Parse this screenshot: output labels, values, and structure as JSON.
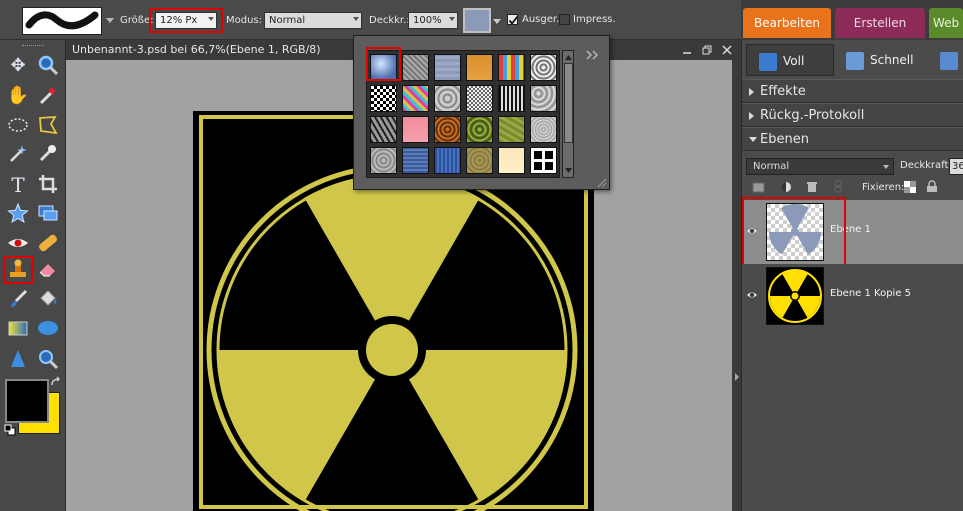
{
  "options_bar": {
    "size_label": "Größe:",
    "size_value": "12% Px",
    "mode_label": "Modus:",
    "mode_value": "Normal",
    "opacity_label": "Deckkr.:",
    "opacity_value": "100%",
    "aligned_label": "Ausger.",
    "aligned_checked": true,
    "impress_label": "Impress.",
    "impress_checked": false
  },
  "mode_tabs": [
    {
      "label": "Bearbeiten",
      "color": "#e8731a"
    },
    {
      "label": "Erstellen",
      "color": "#8c2a58"
    },
    {
      "label": "Web",
      "color": "#5a8a2a"
    }
  ],
  "document": {
    "title": "Unbenannt-3.psd bei 66,7%(Ebene 1, RGB/8)"
  },
  "pattern_picker": {
    "selected_index": 0
  },
  "right_panel": {
    "buttons": [
      {
        "label": "Voll",
        "icon": "pencil-icon"
      },
      {
        "label": "Schnell",
        "icon": "pencil-icon"
      }
    ],
    "sections": {
      "effects": "Effekte",
      "history": "Rückg.-Protokoll",
      "layers": "Ebenen"
    },
    "layers_panel": {
      "blend_mode": "Normal",
      "opacity_label": "Deckkraft:",
      "opacity_value": "36",
      "lock_label": "Fixieren:",
      "layers": [
        {
          "name": "Ebene 1",
          "selected": true
        },
        {
          "name": "Ebene 1 Kopie 5",
          "selected": false
        }
      ]
    }
  },
  "colors": {
    "foreground": "#000000",
    "background": "#ffe000",
    "artwork_yellow": "#cfc64a",
    "highlight": "#e00000"
  }
}
